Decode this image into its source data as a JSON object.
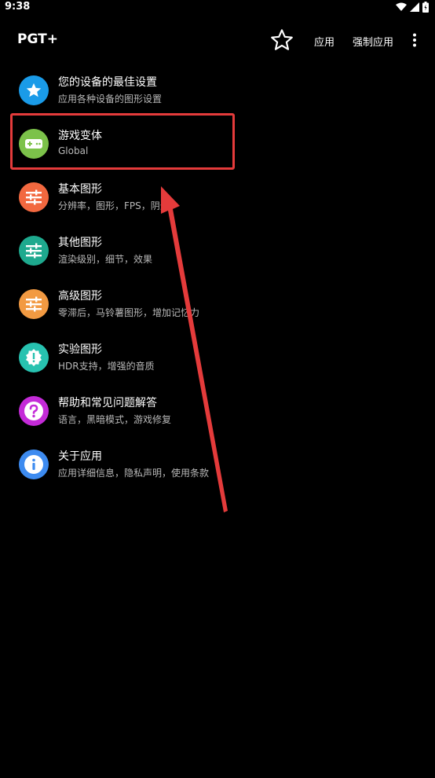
{
  "status": {
    "time": "9:38",
    "icons": [
      "wifi-icon",
      "signal-icon",
      "battery-icon"
    ]
  },
  "app_bar": {
    "title": "PGT+",
    "star_icon": "star-outline-icon",
    "action_apply": "应用",
    "action_force_apply": "强制应用",
    "more_icon": "more-vert-icon"
  },
  "menu": [
    {
      "title": "您的设备的最佳设置",
      "subtitle": "应用各种设备的图形设置",
      "icon": "star-icon",
      "color": "#1a9be8"
    },
    {
      "title": "游戏变体",
      "subtitle": "Global",
      "icon": "gamepad-icon",
      "color": "#7cc24a"
    },
    {
      "title": "基本图形",
      "subtitle": "分辨率，图形，FPS，阴影",
      "icon": "tune-icon",
      "color": "#f2683f"
    },
    {
      "title": "其他图形",
      "subtitle": "渲染级别，细节，效果",
      "icon": "tune-icon",
      "color": "#1ea98e"
    },
    {
      "title": "高级图形",
      "subtitle": "零滞后，马铃薯图形，增加记忆力",
      "icon": "tune-icon",
      "color": "#f29a42"
    },
    {
      "title": "实验图形",
      "subtitle": "HDR支持，增强的音质",
      "icon": "alert-badge-icon",
      "color": "#27c2b0"
    },
    {
      "title": "帮助和常见问题解答",
      "subtitle": "语言，黑暗模式，游戏修复",
      "icon": "help-icon",
      "color": "#c42bd8"
    },
    {
      "title": "关于应用",
      "subtitle": "应用详细信息，隐私声明，使用条款",
      "icon": "info-icon",
      "color": "#3d8bf0"
    }
  ],
  "annotation": {
    "highlight_color": "#e43b3b",
    "arrow_color": "#e43b3b"
  }
}
